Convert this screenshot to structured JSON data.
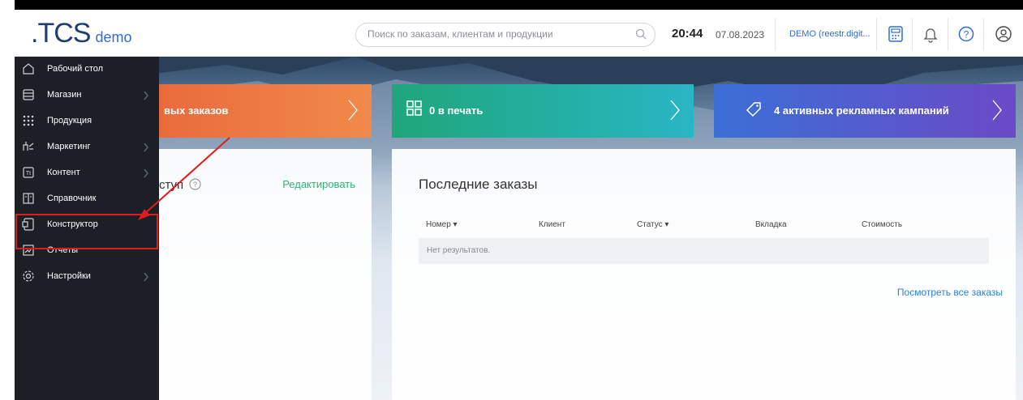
{
  "header": {
    "logo": ".TCS",
    "logo_suffix": "demo",
    "search_placeholder": "Поиск по заказам, клиентам и продукции",
    "time": "20:44",
    "date": "07.08.2023",
    "account": "DEMO (reestr.digit..."
  },
  "tiles": [
    {
      "label": "вых заказов"
    },
    {
      "label": "0 в печать"
    },
    {
      "label": "4 активных рекламных кампаний"
    }
  ],
  "left_panel": {
    "title": "ступ",
    "edit": "Редактировать"
  },
  "orders": {
    "title": "Последние заказы",
    "columns": [
      "Номер ▾",
      "Клиент",
      "Статус ▾",
      "Вкладка",
      "Стоимость"
    ],
    "empty": "Нет результатов.",
    "view_all": "Посмотреть все заказы"
  },
  "sidebar": {
    "items": [
      {
        "label": "Рабочий стол",
        "icon": "home-icon",
        "submenu": false
      },
      {
        "label": "Магазин",
        "icon": "store-icon",
        "submenu": true
      },
      {
        "label": "Продукция",
        "icon": "grid-icon",
        "submenu": false
      },
      {
        "label": "Маркетинг",
        "icon": "marketing-icon",
        "submenu": true
      },
      {
        "label": "Контент",
        "icon": "content-icon",
        "submenu": true
      },
      {
        "label": "Справочник",
        "icon": "book-icon",
        "submenu": false
      },
      {
        "label": "Конструктор",
        "icon": "constructor-icon",
        "submenu": false
      },
      {
        "label": "Отчеты",
        "icon": "reports-icon",
        "submenu": false
      },
      {
        "label": "Настройки",
        "icon": "gear-icon",
        "submenu": true
      }
    ]
  },
  "colors": {
    "sidebar_bg": "#1c2026",
    "highlight": "#e01b1b",
    "accent_green": "#2bb673",
    "accent_blue": "#2f7fd8"
  }
}
